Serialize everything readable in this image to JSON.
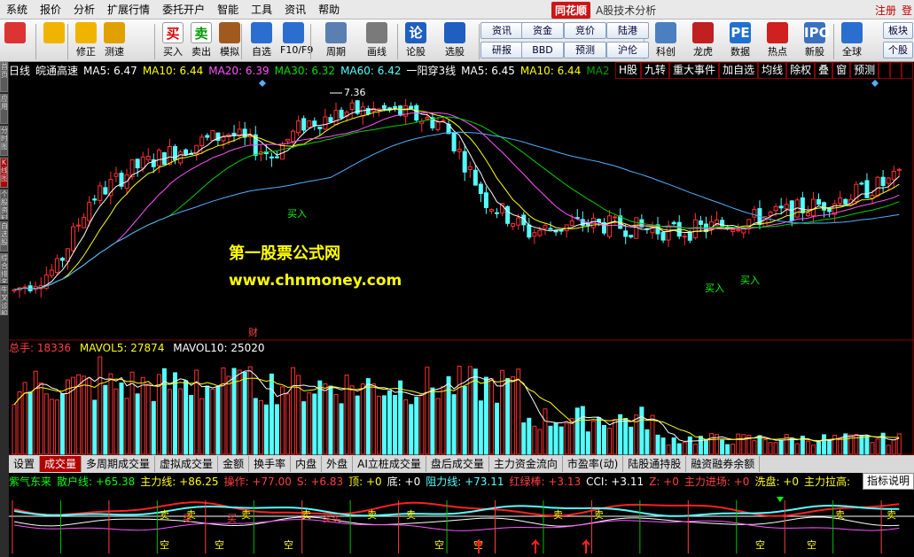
{
  "menubar": {
    "items": [
      "系统",
      "报价",
      "分析",
      "扩展行情",
      "委托开户",
      "智能",
      "工具",
      "资讯",
      "帮助"
    ],
    "brand": "同花顺",
    "brand_sub": "A股技术分析",
    "right_items": [
      "注册",
      "登"
    ]
  },
  "toolbar": {
    "big_buttons": [
      {
        "label": "",
        "icon": "color-grid-icon"
      },
      {
        "label": "",
        "icon": "back-arrow-icon"
      },
      {
        "label": "修正",
        "icon": "updown-arrow-icon"
      },
      {
        "label": "测速",
        "icon": "speed-icon"
      },
      {
        "label": "买入",
        "icon": "buy-icon",
        "glyph": "买"
      },
      {
        "label": "卖出",
        "icon": "sell-icon",
        "glyph": "卖"
      },
      {
        "label": "模拟",
        "icon": "hammer-icon"
      },
      {
        "label": "自选",
        "icon": "star-icon"
      },
      {
        "label": "F10/F9",
        "icon": "f10-icon"
      },
      {
        "label": "周期",
        "icon": "clock-icon"
      },
      {
        "label": "画线",
        "icon": "pencil-icon"
      },
      {
        "label": "论股",
        "icon": "discuss-icon",
        "glyph": "论"
      },
      {
        "label": "选股",
        "icon": "search-icon"
      },
      {
        "label": "科创",
        "icon": "chart-icon"
      },
      {
        "label": "龙虎",
        "icon": "dragon-icon"
      },
      {
        "label": "数据",
        "icon": "pe-icon",
        "glyph": "PE"
      },
      {
        "label": "热点",
        "icon": "hot-icon"
      },
      {
        "label": "新股",
        "icon": "ipo-icon",
        "glyph": "IPO"
      },
      {
        "label": "全球",
        "icon": "globe-icon"
      }
    ],
    "small_buttons": [
      [
        "资讯",
        "研报"
      ],
      [
        "资金",
        "BBD"
      ],
      [
        "竞价",
        "预测"
      ],
      [
        "陆港",
        "沪伦"
      ],
      [
        "板块",
        "个股"
      ]
    ]
  },
  "left_tabs": [
    "首页",
    "应用",
    "分时图",
    "K线图",
    "个股资料",
    "自选股",
    "综合排名",
    "牛叉诊股"
  ],
  "infobar": {
    "period": "日线",
    "stock": "皖通高速",
    "ma5": "MA5: 6.47",
    "ma10": "MA10: 6.44",
    "ma20": "MA20: 6.39",
    "ma30": "MA30: 6.32",
    "ma60": "MA60: 6.42",
    "pattern": "一阳穿3线",
    "p_ma5": "MA5: 6.45",
    "p_ma10": "MA10: 6.44",
    "p_ma2": "MA2"
  },
  "right_tabs": [
    "H股",
    "九转",
    "重大事件",
    "加自选",
    "均线",
    "除权",
    "叠",
    "窗",
    "预测"
  ],
  "main_chart": {
    "high_label": "7.36",
    "buy_label": "买入",
    "fin_label": "财",
    "watermark_1": "第一股票公式网",
    "watermark_2": "www.chnmoney.com"
  },
  "volume": {
    "total_label": "总手: 18336",
    "mavol5": "MAVOL5: 27874",
    "mavol10": "MAVOL10: 25020"
  },
  "bottom_tabs": [
    "设置",
    "成交量",
    "多周期成交量",
    "虚拟成交量",
    "金额",
    "换手率",
    "内盘",
    "外盘",
    "AI立桩成交量",
    "盘后成交量",
    "主力资金流向",
    "市盈率(动)",
    "陆股通持股",
    "融资融券余额"
  ],
  "indicator": {
    "name": "紫气东来",
    "items": [
      "散户线: +65.38",
      "主力线: +86.25",
      "操作: +77.00",
      "S: +6.83",
      "顶: +0",
      "底: +0",
      "阻力线: +73.11",
      "红绿棒: +3.13",
      "CCI: +3.11",
      "Z: +0",
      "主力进场: +0",
      "洗盘: +0",
      "主力拉高: "
    ],
    "help": "指标说明",
    "sell_label": "卖",
    "buy_label": "买",
    "empty_label": "空"
  },
  "colors": {
    "red": "#ff3030",
    "cyan": "#54ffff",
    "yellow": "#ffff00",
    "white": "#ffffff",
    "magenta": "#ff55ff",
    "green": "#00d000",
    "blue": "#4fb0ff"
  }
}
